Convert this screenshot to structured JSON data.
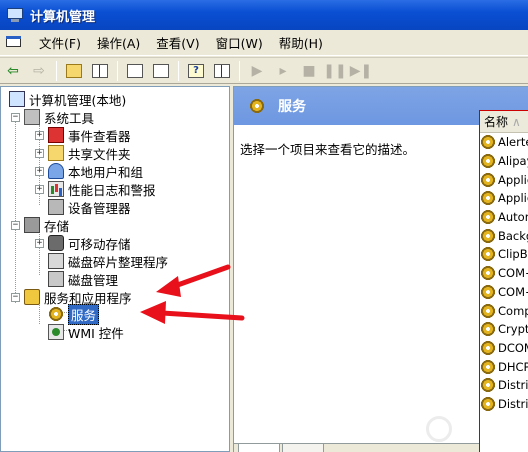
{
  "window": {
    "title": "计算机管理"
  },
  "menu": {
    "items": [
      "文件(F)",
      "操作(A)",
      "查看(V)",
      "窗口(W)",
      "帮助(H)"
    ]
  },
  "toolbar": {
    "buttons": [
      "back-arrow",
      "forward-arrow",
      "up-folder",
      "show-tree",
      "refresh",
      "export",
      "help",
      "properties",
      "play",
      "play-next",
      "stop",
      "pause",
      "restart"
    ]
  },
  "tree": {
    "root": "计算机管理(本地)",
    "system_tools": "系统工具",
    "event_viewer": "事件查看器",
    "shared_folders": "共享文件夹",
    "local_users": "本地用户和组",
    "perf_logs": "性能日志和警报",
    "device_manager": "设备管理器",
    "storage": "存储",
    "removable_storage": "可移动存储",
    "defrag": "磁盘碎片整理程序",
    "disk_mgmt": "磁盘管理",
    "services_apps": "服务和应用程序",
    "services": "服务",
    "wmi": "WMI 控件"
  },
  "right_pane": {
    "header": "服务",
    "description": "选择一个项目来查看它的描述。",
    "column_name": "名称",
    "column_next": "∧",
    "rows": [
      "Alerter",
      "Alipay",
      "Applic",
      "Applic",
      "Autom",
      "Backgr",
      "ClipBo",
      "COM+",
      "COM+",
      "Compu",
      "Crypto",
      "DCOM",
      "DHCP",
      "Distrib",
      "Distrib"
    ]
  },
  "colors": {
    "titlebar": "#0a4fd4",
    "header": "#6d97e1",
    "selection": "#316ac5",
    "annotation": "#e8101a"
  }
}
